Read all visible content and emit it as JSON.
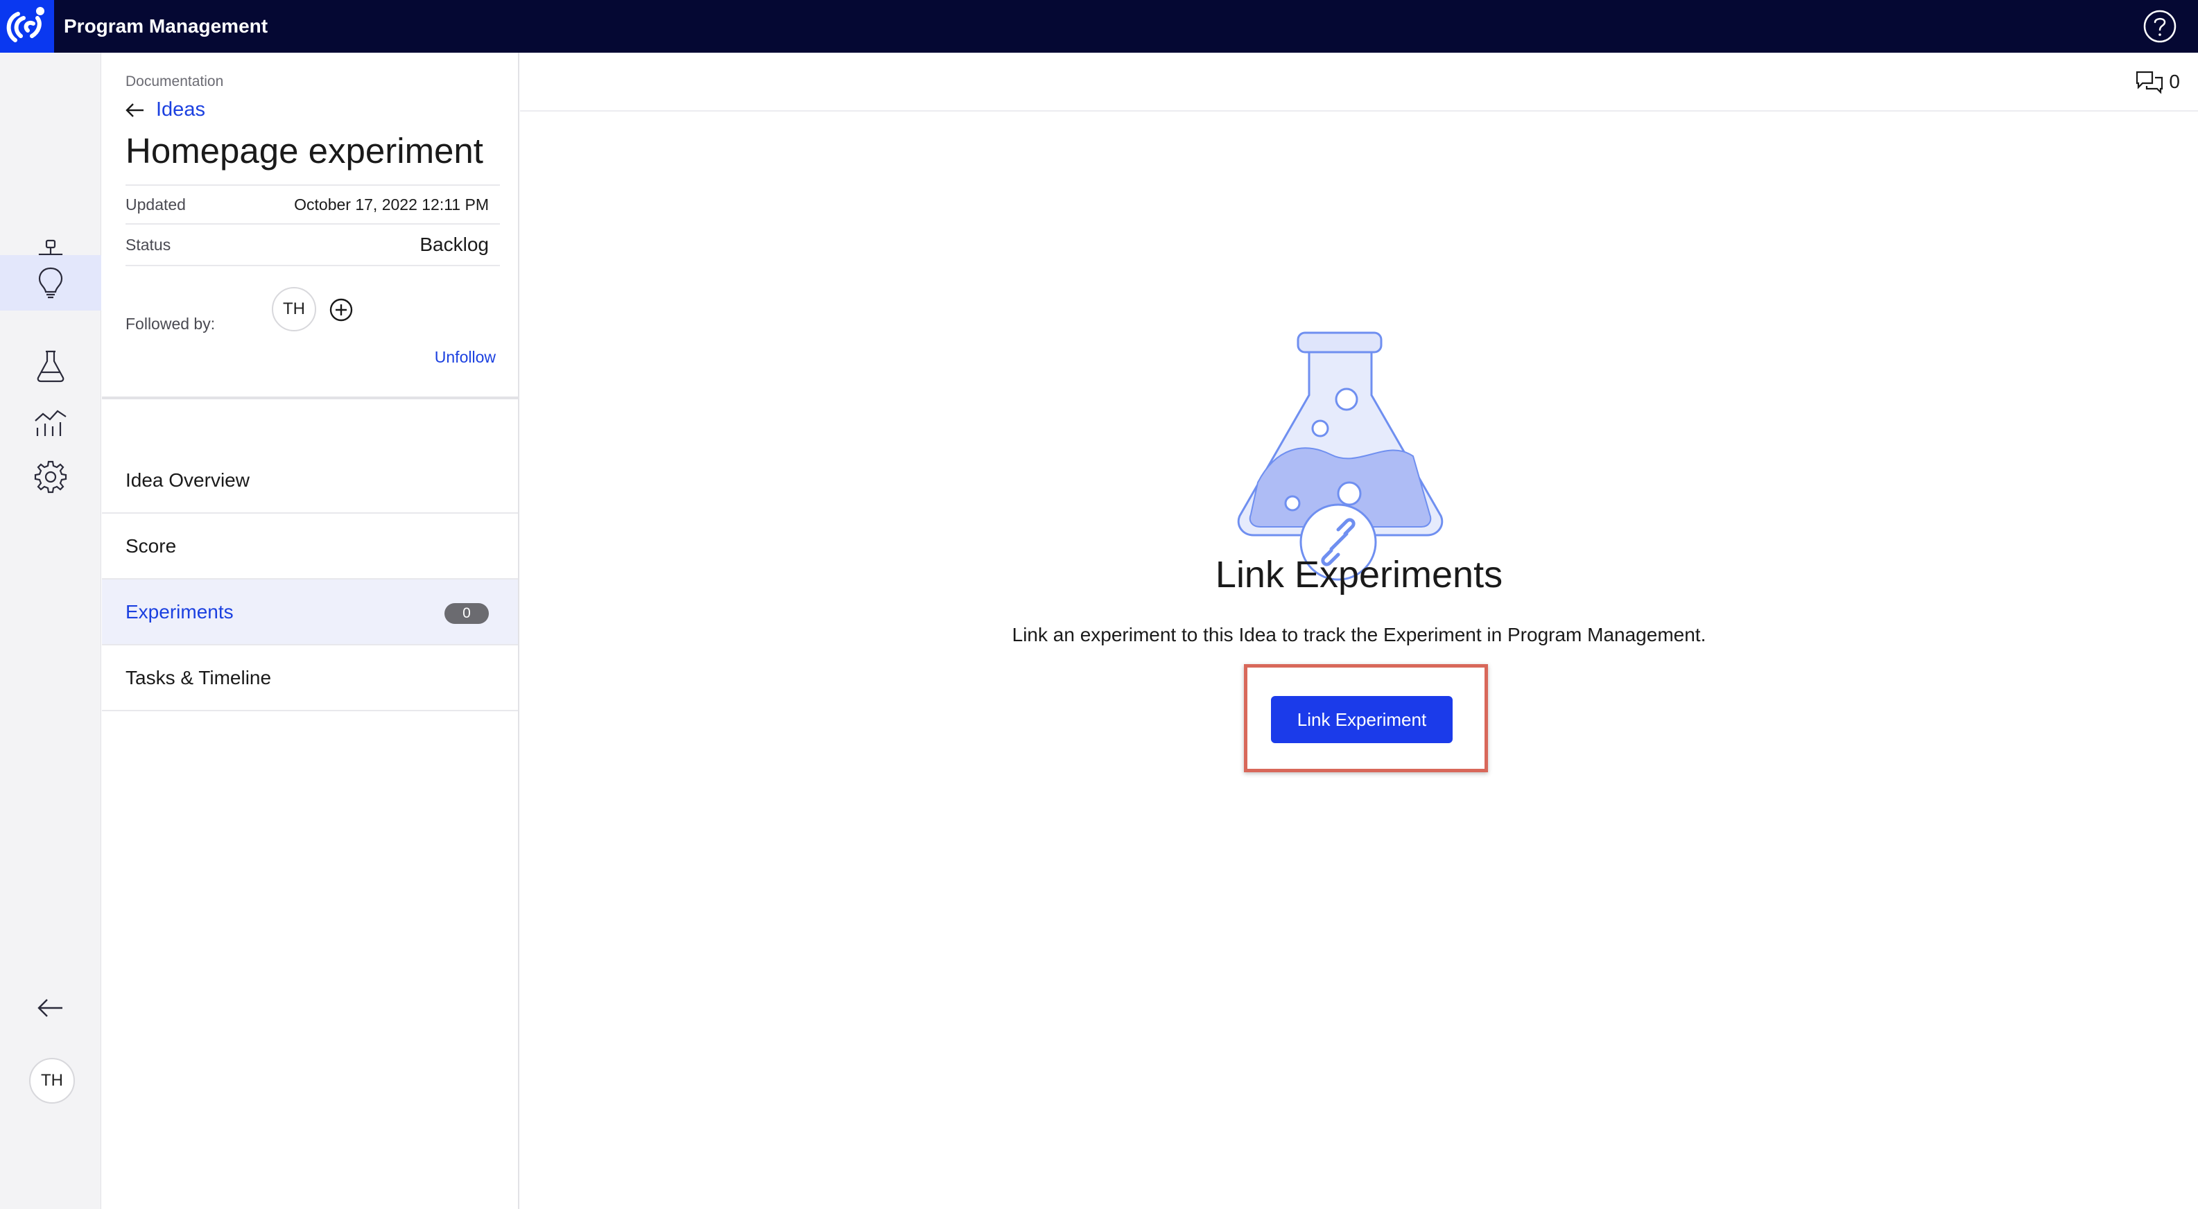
{
  "app": {
    "title": "Program Management",
    "colors": {
      "topbar": "#050833",
      "accent": "#1b40e0",
      "button": "#1b3bea",
      "highlight": "#d8685a"
    }
  },
  "rail": {
    "items": [
      {
        "name": "hierarchy-icon",
        "active": false
      },
      {
        "name": "lightbulb-icon",
        "active": true
      },
      {
        "name": "flask-icon",
        "active": false
      },
      {
        "name": "analytics-icon",
        "active": false
      },
      {
        "name": "gear-icon",
        "active": false
      }
    ],
    "collapse_icon": "arrow-left-icon",
    "user_initials": "TH"
  },
  "detail": {
    "breadcrumb": "Documentation",
    "back_label": "Ideas",
    "title": "Homepage experiment",
    "updated_label": "Updated",
    "updated_value": "October 17, 2022 12:11 PM",
    "status_label": "Status",
    "status_value": "Backlog",
    "followed_by_label": "Followed by:",
    "follower_initials": "TH",
    "unfollow_label": "Unfollow",
    "nav": [
      {
        "label": "Idea Overview"
      },
      {
        "label": "Score"
      },
      {
        "label": "Experiments",
        "badge": "0",
        "active": true
      },
      {
        "label": "Tasks & Timeline"
      }
    ]
  },
  "main": {
    "comments_count": "0",
    "empty_title": "Link Experiments",
    "empty_description": "Link an experiment to this Idea to track the Experiment in Program Management.",
    "link_button_label": "Link Experiment"
  }
}
